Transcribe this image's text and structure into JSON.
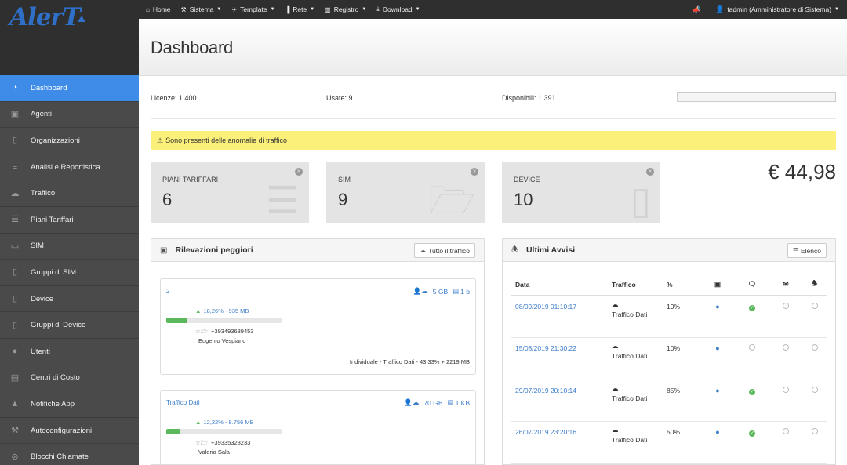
{
  "app": {
    "logo": "AlerT"
  },
  "sidebar": {
    "items": [
      {
        "label": "Dashboard",
        "icon": "dashboard-icon",
        "active": true
      },
      {
        "label": "Agenti",
        "icon": "briefcase-icon"
      },
      {
        "label": "Organizzazioni",
        "icon": "building-icon"
      },
      {
        "label": "Analisi e Reportistica",
        "icon": "chart-icon"
      },
      {
        "label": "Traffico",
        "icon": "cloud-icon"
      },
      {
        "label": "Piani Tariffari",
        "icon": "list-icon"
      },
      {
        "label": "SIM",
        "icon": "folder-icon"
      },
      {
        "label": "Gruppi di SIM",
        "icon": "mobile-icon"
      },
      {
        "label": "Device",
        "icon": "mobile-icon"
      },
      {
        "label": "Gruppi di Device",
        "icon": "mobile-icon"
      },
      {
        "label": "Utenti",
        "icon": "user-icon"
      },
      {
        "label": "Centri di Costo",
        "icon": "money-icon"
      },
      {
        "label": "Notifiche App",
        "icon": "bell-icon"
      },
      {
        "label": "Autoconfigurazioni",
        "icon": "wrench-icon"
      },
      {
        "label": "Blocchi Chiamate",
        "icon": "ban-icon"
      }
    ]
  },
  "topnav": {
    "items": [
      {
        "label": "Home",
        "icon": "home-icon",
        "caret": false
      },
      {
        "label": "Sistema",
        "icon": "wrench-icon",
        "caret": true
      },
      {
        "label": "Template",
        "icon": "plane-icon",
        "caret": true
      },
      {
        "label": "Rete",
        "icon": "signal-icon",
        "caret": true
      },
      {
        "label": "Registro",
        "icon": "book-icon",
        "caret": true
      },
      {
        "label": "Download",
        "icon": "download-icon",
        "caret": true
      }
    ],
    "user": "tadmin (Amministratore di Sistema)"
  },
  "page": {
    "title": "Dashboard"
  },
  "licenses": {
    "total": "Licenze: 1.400",
    "used": "Usate: 9",
    "available": "Disponibili: 1.391",
    "usage_fraction": 0.006
  },
  "alert": {
    "text": "Sono presenti delle anomalie di traffico"
  },
  "cards": [
    {
      "label": "PIANI TARIFFARI",
      "value": "6"
    },
    {
      "label": "SIM",
      "value": "9"
    },
    {
      "label": "DEVICE",
      "value": "10"
    }
  ],
  "total_amount": "€ 44,98",
  "worst_panel": {
    "title": "Rilevazioni peggiori",
    "button": "Tutto il traffico",
    "items": [
      {
        "name": "2",
        "data": "5 GB",
        "sms": "1 b",
        "trend": "18,26% - 935 MB",
        "progress": 0.18,
        "number": "+393493689453",
        "user": "Eugenio Vespiano",
        "footer": "Individuale - Traffico Dati - 43,33% + 2219 MB"
      },
      {
        "name": "Traffico Dati",
        "data": "70 GB",
        "sms": "1 KB",
        "trend": "12,22% - 8.756 MB",
        "progress": 0.12,
        "number": "+39335328233",
        "user": "Valeria Sala",
        "footer": ""
      }
    ]
  },
  "notices_panel": {
    "title": "Ultimi Avvisi",
    "button": "Elenco",
    "columns": [
      "Data",
      "Traffico",
      "%"
    ],
    "rows": [
      {
        "date": "08/09/2019 01:10:17",
        "traffic": "Traffico Dati",
        "pct": "10%",
        "sent": true
      },
      {
        "date": "15/08/2019 21:30:22",
        "traffic": "Traffico Dati",
        "pct": "10%",
        "sent": false
      },
      {
        "date": "29/07/2019 20:10:14",
        "traffic": "Traffico Dati",
        "pct": "85%",
        "sent": true
      },
      {
        "date": "26/07/2019 23:20:16",
        "traffic": "Traffico Dati",
        "pct": "50%",
        "sent": true
      }
    ]
  },
  "colors": {
    "accent": "#3f8ce8",
    "link": "#3a7bc8",
    "success": "#5cb85c",
    "alert_bg": "#fbf07a",
    "sidebar_bg": "#4a4a4a",
    "topbar_bg": "#2f2f2f"
  }
}
